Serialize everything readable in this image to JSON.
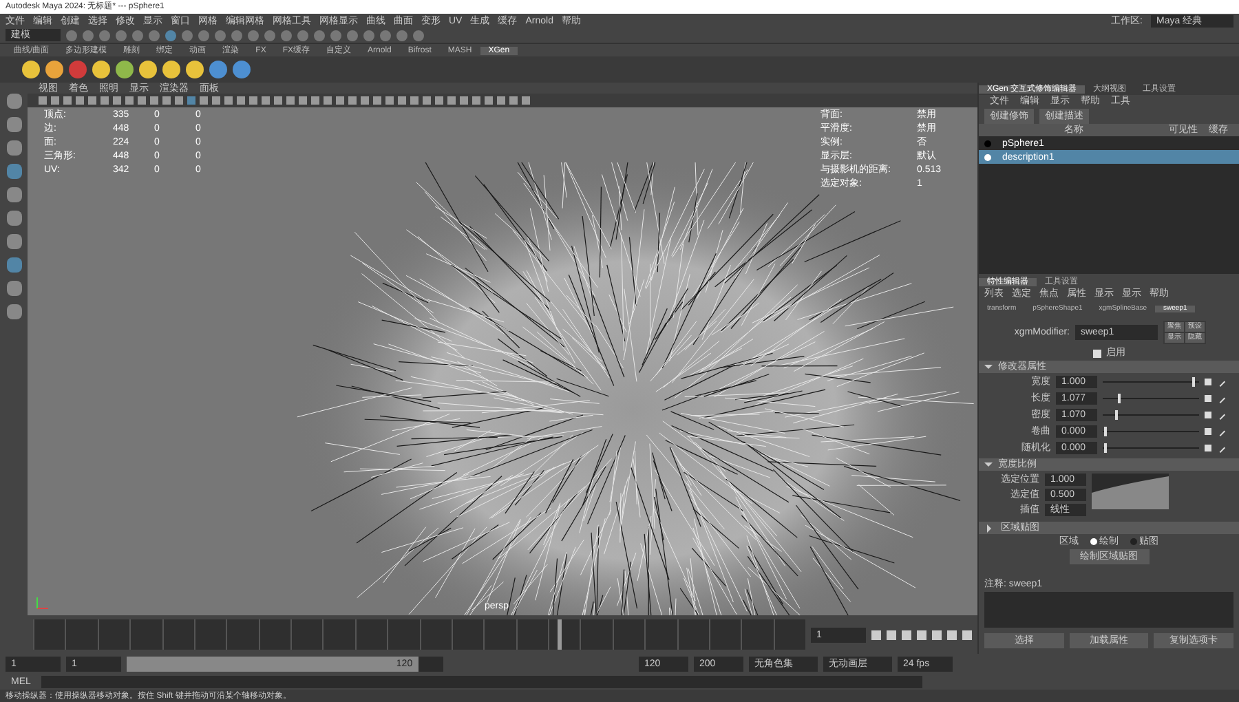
{
  "window": {
    "title": "Autodesk Maya 2024: 无标题* --- pSphere1"
  },
  "menu_bar": [
    "文件",
    "编辑",
    "创建",
    "选择",
    "修改",
    "显示",
    "窗口",
    "网格",
    "编辑网格",
    "网格工具",
    "网格显示",
    "曲线",
    "曲面",
    "变形",
    "UV",
    "生成",
    "缓存",
    "Arnold",
    "帮助"
  ],
  "mode_menu": "建模",
  "workspace": {
    "label": "工作区:",
    "value": "Maya 经典"
  },
  "shelf_tabs": [
    {
      "label": "曲线/曲面",
      "selected": false
    },
    {
      "label": "多边形建模",
      "selected": false
    },
    {
      "label": "雕刻",
      "selected": false
    },
    {
      "label": "绑定",
      "selected": false
    },
    {
      "label": "动画",
      "selected": false
    },
    {
      "label": "渲染",
      "selected": false
    },
    {
      "label": "FX",
      "selected": false
    },
    {
      "label": "FX缓存",
      "selected": false
    },
    {
      "label": "自定义",
      "selected": false
    },
    {
      "label": "Arnold",
      "selected": false
    },
    {
      "label": "Bifrost",
      "selected": false
    },
    {
      "label": "MASH",
      "selected": false
    },
    {
      "label": "XGen",
      "selected": true
    }
  ],
  "viewport": {
    "menus": [
      "视图",
      "着色",
      "照明",
      "显示",
      "渲染器",
      "面板"
    ],
    "camera_name": "persp",
    "hud_left": [
      {
        "label": "顶点:",
        "values": [
          "335",
          "0",
          "0"
        ]
      },
      {
        "label": "边:",
        "values": [
          "448",
          "0",
          "0"
        ]
      },
      {
        "label": "面:",
        "values": [
          "224",
          "0",
          "0"
        ]
      },
      {
        "label": "三角形:",
        "values": [
          "448",
          "0",
          "0"
        ]
      },
      {
        "label": "UV:",
        "values": [
          "342",
          "0",
          "0"
        ]
      }
    ],
    "hud_right": [
      {
        "label": "背面:",
        "value": "禁用"
      },
      {
        "label": "平滑度:",
        "value": "禁用"
      },
      {
        "label": "实例:",
        "value": "否"
      },
      {
        "label": "显示层:",
        "value": "默认"
      },
      {
        "label": "与摄影机的距离:",
        "value": "0.513"
      },
      {
        "label": "选定对象:",
        "value": "1"
      }
    ]
  },
  "xgen_panel": {
    "tabs": [
      {
        "label": "XGen 交互式修饰编辑器",
        "selected": true
      },
      {
        "label": "大纲视图",
        "selected": false
      },
      {
        "label": "工具设置",
        "selected": false
      }
    ],
    "menus": [
      "文件",
      "编辑",
      "显示",
      "帮助",
      "工具"
    ],
    "buttons": [
      "创建修饰",
      "创建描述"
    ],
    "columns": [
      "名称",
      "可见性",
      "缓存"
    ],
    "items": [
      {
        "name": "pSphere1",
        "selected": false
      },
      {
        "name": "description1",
        "selected": true
      }
    ]
  },
  "attribute_editor": {
    "tabs": [
      {
        "label": "特性编辑器",
        "selected": true
      },
      {
        "label": "工具设置",
        "selected": false
      }
    ],
    "menus": [
      "列表",
      "选定",
      "焦点",
      "属性",
      "显示",
      "显示",
      "帮助"
    ],
    "node_tabs": [
      {
        "label": "transform",
        "selected": false
      },
      {
        "label": "pSphereShape1",
        "selected": false
      },
      {
        "label": "xgmSplineBase",
        "selected": false
      },
      {
        "label": "sweep1",
        "selected": true
      }
    ],
    "node_label": "xgmModifier:",
    "node_value": "sweep1",
    "side_buttons": [
      "聚焦",
      "预设",
      "显示",
      "隐藏"
    ],
    "enable_label": "启用",
    "enable_checked": true,
    "sections": [
      {
        "title": "修改器属性",
        "expanded": true,
        "rows": [
          {
            "label": "宽度",
            "value": "1.000",
            "level": 0.95
          },
          {
            "label": "长度",
            "value": "1.077",
            "level": 0.16
          },
          {
            "label": "密度",
            "value": "1.070",
            "level": 0.13
          },
          {
            "label": "卷曲",
            "value": "0.000",
            "level": 0.02
          },
          {
            "label": "随机化",
            "value": "0.000",
            "level": 0.02
          }
        ]
      },
      {
        "title": "宽度比例",
        "expanded": true,
        "ramp": {
          "fields": [
            {
              "label": "选定位置",
              "value": "1.000"
            },
            {
              "label": "选定值",
              "value": "0.500"
            },
            {
              "label": "插值",
              "value": "线性"
            }
          ]
        }
      },
      {
        "title": "区域贴图",
        "expanded": false
      }
    ],
    "radio_label": "区域",
    "radios": [
      {
        "label": "绘制",
        "selected": true
      },
      {
        "label": "贴图",
        "selected": false
      }
    ],
    "paint_button": "绘制区域贴图",
    "notes_label": "注释: sweep1",
    "footer_buttons": [
      "选择",
      "加载属性",
      "复制选项卡"
    ]
  },
  "timeline": {
    "current_frame": "1",
    "playhead": {
      "level": 0.68
    },
    "range": {
      "start": "1",
      "inner_start": "1",
      "inner_end": "120",
      "outer_end": "120",
      "max": "200",
      "level": 0.92
    },
    "char_set": "无角色集",
    "anim_layer": "无动画层",
    "fps": "24 fps"
  },
  "command_line": {
    "label": "MEL"
  },
  "help_line": "移动操纵器：使用操纵器移动对象。按住 Shift 键并拖动可沿某个轴移动对象。"
}
